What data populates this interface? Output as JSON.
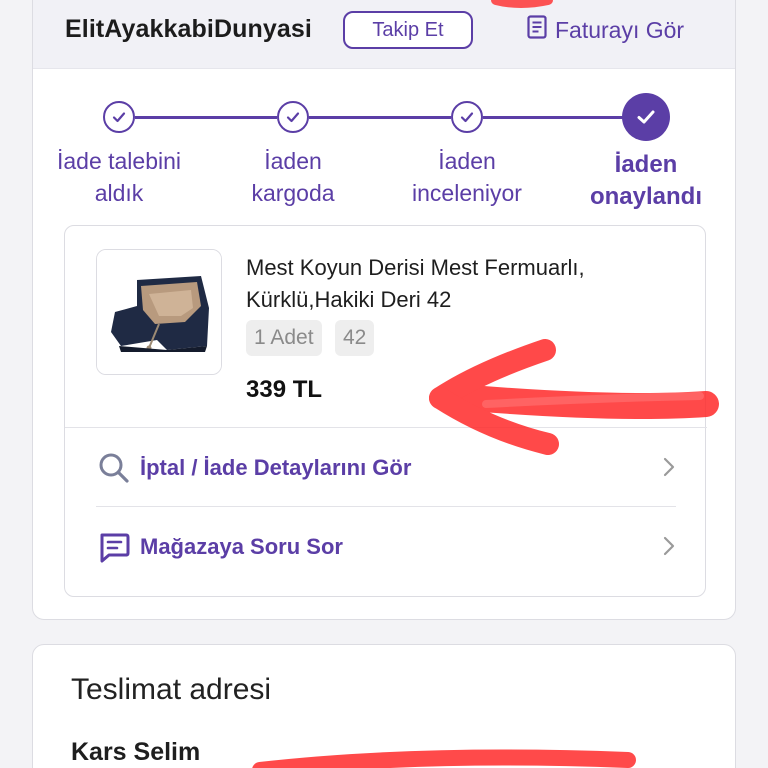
{
  "seller": {
    "name": "ElitAyakkabiDunyasi",
    "follow_label": "Takip Et",
    "invoice_label": "Faturayı Gör"
  },
  "stepper": {
    "steps": [
      {
        "line1": "İade talebini",
        "line2": "aldık",
        "state": "done"
      },
      {
        "line1": "İaden",
        "line2": "kargoda",
        "state": "done"
      },
      {
        "line1": "İaden",
        "line2": "inceleniyor",
        "state": "done"
      },
      {
        "line1": "İaden",
        "line2": "onaylandı",
        "state": "current"
      }
    ]
  },
  "product": {
    "title": "Mest Koyun Derisi Mest Fermuarlı, Kürklü,Hakiki Deri 42",
    "quantity_chip": "1 Adet",
    "size_chip": "42",
    "price": "339 TL"
  },
  "actions": {
    "details_label": "İptal / İade Detaylarını Gör",
    "ask_store_label": "Mağazaya Soru Sor"
  },
  "delivery": {
    "title": "Teslimat adresi",
    "recipient": "Kars Selim"
  },
  "colors": {
    "accent": "#5b3ea6",
    "annotation": "#ff2a2a"
  }
}
